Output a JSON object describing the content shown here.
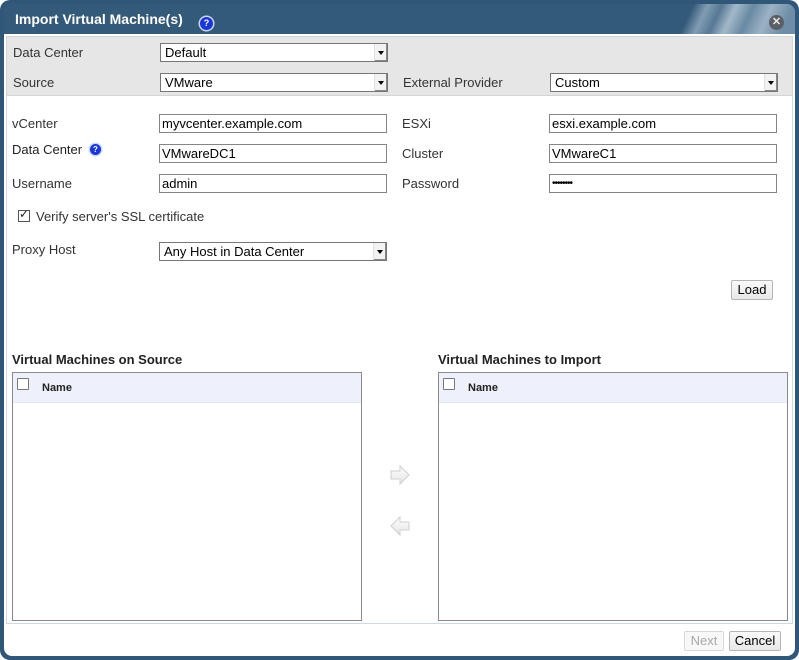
{
  "dialog": {
    "title": "Import Virtual Machine(s)",
    "help_icon": "help-icon",
    "close_icon": "close-icon"
  },
  "top_panel": {
    "data_center": {
      "label": "Data Center",
      "value": "Default"
    },
    "source": {
      "label": "Source",
      "value": "VMware"
    },
    "external_provider": {
      "label": "External Provider",
      "value": "Custom"
    }
  },
  "form": {
    "vcenter": {
      "label": "vCenter",
      "value": "myvcenter.example.com"
    },
    "esxi": {
      "label": "ESXi",
      "value": "esxi.example.com"
    },
    "data_center": {
      "label": "Data Center",
      "value": "VMwareDC1"
    },
    "cluster": {
      "label": "Cluster",
      "value": "VMwareC1"
    },
    "username": {
      "label": "Username",
      "value": "admin"
    },
    "password": {
      "label": "Password",
      "value": "••••••••"
    },
    "verify_ssl": {
      "label": "Verify server's SSL certificate",
      "checked": true
    },
    "proxy_host": {
      "label": "Proxy Host",
      "value": "Any Host in Data Center"
    },
    "load_label": "Load"
  },
  "source_list": {
    "title": "Virtual Machines on Source",
    "columns": [
      "Name"
    ],
    "rows": []
  },
  "import_list": {
    "title": "Virtual Machines to Import",
    "columns": [
      "Name"
    ],
    "rows": []
  },
  "footer": {
    "next_label": "Next",
    "cancel_label": "Cancel"
  }
}
